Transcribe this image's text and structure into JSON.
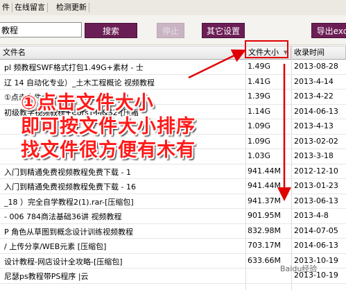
{
  "menu": {
    "items": [
      "件",
      "在线留言",
      "检测更新"
    ]
  },
  "toolbar": {
    "search_value": "教程",
    "search_label": "搜索",
    "stop_label": "停止",
    "other_label": "其它设置",
    "export_label": "导出exc"
  },
  "table": {
    "headers": {
      "name": "文件名",
      "size": "文件大小",
      "date": "收录时间"
    },
    "rows": [
      {
        "name": "pl      频教程SWF格式打包1.49G+素材 - 士",
        "size": "1.49G",
        "date": "2013-08-28"
      },
      {
        "name": "辽    14 自动化专业）_土木工程概论 视频教程",
        "size": "1.41G",
        "date": "2013-4-14"
      },
      {
        "name": "    ①点击文件大小",
        "size": "1.39G",
        "date": "2013-4-22"
      },
      {
        "name": "    初级教学视频教程+CorsT-M&S2-[压缩",
        "size": "1.14G",
        "date": "2014-06-13"
      },
      {
        "name": "",
        "size": "1.09G",
        "date": "2013-4-13"
      },
      {
        "name": "",
        "size": "1.09G",
        "date": "2013-02-02"
      },
      {
        "name": "",
        "size": "1.03G",
        "date": "2013-3-18"
      },
      {
        "name": "                 入门到精通免费视频教程免费下载 - 1",
        "size": "941.44M",
        "date": "2012-12-10"
      },
      {
        "name": "                 入门到精通免费视频教程免费下载 - 16",
        "size": "941.44M",
        "date": "2013-01-23"
      },
      {
        "name": "_18          ）完全自学教程2(1).rar-[压缩包]",
        "size": "941.37M",
        "date": "2013-06-13"
      },
      {
        "name": "            - 006   784商法基础36讲 视频教程",
        "size": "901.95M",
        "date": "2013-4-8"
      },
      {
        "name": "P            角色从草图到概念设计训练视频教程",
        "size": "832.98M",
        "date": "2014-07-05"
      },
      {
        "name": "/              上传分享/WEB元素  [压缩包]",
        "size": "703.17M",
        "date": "2014-06-13"
      },
      {
        "name": "            设计教程-网店设计全攻略-[压缩包]",
        "size": "633.66M",
        "date": "2013-10-19"
      },
      {
        "name": "                尼瑟ps教程带PS程序 |云",
        "size": "",
        "date": "2013-10-19"
      }
    ]
  },
  "annotation": {
    "line1": "①点击文件大小",
    "line2": "即可按文件大小排序",
    "line3": "找文件很方便有木有"
  },
  "watermark": "Baidu经验",
  "colors": {
    "accent": "#6b1e55",
    "highlight": "#e00000"
  }
}
